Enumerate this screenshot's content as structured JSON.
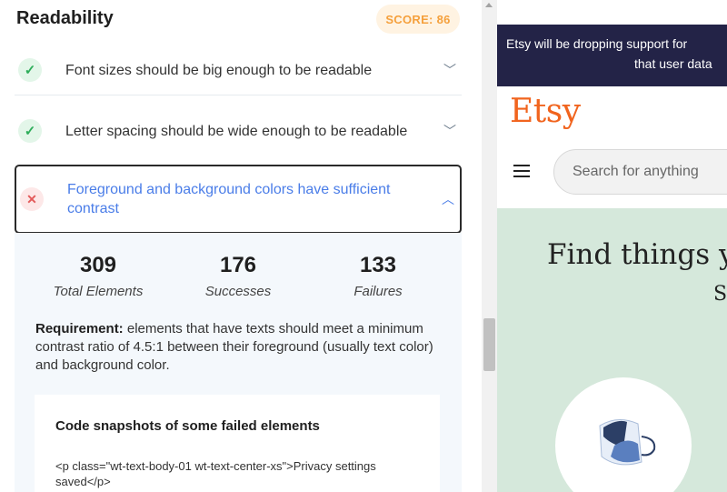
{
  "panel": {
    "title": "Readability",
    "score": "SCORE: 86"
  },
  "checks": [
    {
      "status": "pass",
      "icon": "check-icon",
      "label": "Font sizes should be big enough to be readable"
    },
    {
      "status": "pass",
      "icon": "check-icon",
      "label": "Letter spacing should be wide enough to be readable"
    },
    {
      "status": "fail",
      "icon": "cross-icon",
      "label": "Foreground and background colors have sufficient contrast"
    }
  ],
  "details": {
    "stats": [
      {
        "value": "309",
        "label": "Total Elements"
      },
      {
        "value": "176",
        "label": "Successes"
      },
      {
        "value": "133",
        "label": "Failures"
      }
    ],
    "requirement_label": "Requirement:",
    "requirement_text": " elements that have texts should meet a minimum contrast ratio of 4.5:1 between their foreground (usually text color) and background color.",
    "snapshots_title": "Code snapshots of some failed elements",
    "snapshot_code": "<p class=\"wt-text-body-01 wt-text-center-xs\">Privacy settings saved</p>"
  },
  "preview": {
    "banner_line1": "Etsy will be dropping support for",
    "banner_line2": "that user data",
    "logo": "Etsy",
    "search_placeholder": "Search for anything",
    "hero_title": "Find things y",
    "hero_sub": "S"
  },
  "colors": {
    "score_text": "#f5a03c",
    "score_bg": "#fff3e2",
    "pass": "#2fae5b",
    "fail": "#e35b5b",
    "link_blue": "#4a7de8",
    "etsy_orange": "#f1641e",
    "banner_bg": "#232347",
    "hero_bg": "#d5e8db"
  }
}
